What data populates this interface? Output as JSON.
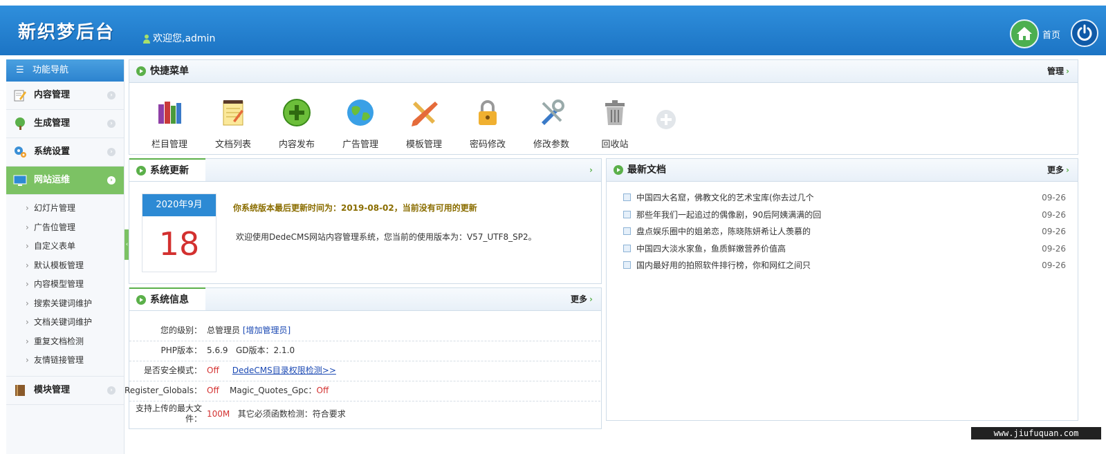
{
  "header": {
    "logo": "新织梦后台",
    "welcome": "欢迎您,admin",
    "home_label": "首页"
  },
  "sidebar": {
    "title": "功能导航",
    "menus": [
      {
        "label": "内容管理"
      },
      {
        "label": "生成管理"
      },
      {
        "label": "系统设置"
      },
      {
        "label": "网站运维"
      }
    ],
    "sub_items": [
      "幻灯片管理",
      "广告位管理",
      "自定义表单",
      "默认模板管理",
      "内容模型管理",
      "搜索关键词维护",
      "文档关键词维护",
      "重复文档检测",
      "友情链接管理"
    ],
    "module_menu": "模块管理"
  },
  "quick_menu": {
    "title": "快捷菜单",
    "manage": "管理",
    "items": [
      {
        "label": "栏目管理",
        "icon": "books-icon"
      },
      {
        "label": "文档列表",
        "icon": "notepad-icon"
      },
      {
        "label": "内容发布",
        "icon": "plus-circle-icon"
      },
      {
        "label": "广告管理",
        "icon": "globe-icon"
      },
      {
        "label": "模板管理",
        "icon": "pencil-ruler-icon"
      },
      {
        "label": "密码修改",
        "icon": "lock-icon"
      },
      {
        "label": "修改参数",
        "icon": "tools-icon"
      },
      {
        "label": "回收站",
        "icon": "trash-icon"
      }
    ]
  },
  "system_update": {
    "title": "系统更新",
    "month": "2020年9月",
    "day": "18",
    "message": "你系统版本最后更新时间为：2019-08-02，当前没有可用的更新",
    "description": "欢迎使用DedeCMS网站内容管理系统，您当前的使用版本为：V57_UTF8_SP2。"
  },
  "latest_docs": {
    "title": "最新文档",
    "more": "更多",
    "items": [
      {
        "title": "中国四大名窟，佛教文化的艺术宝库(你去过几个",
        "date": "09-26"
      },
      {
        "title": "那些年我们一起追过的偶像剧，90后阿姨满满的回",
        "date": "09-26"
      },
      {
        "title": "盘点娱乐圈中的姐弟恋，陈晓陈妍希让人羡慕的",
        "date": "09-26"
      },
      {
        "title": "中国四大淡水家鱼，鱼质鲜嫩营养价值高",
        "date": "09-26"
      },
      {
        "title": "国内最好用的拍照软件排行榜，你和网红之间只",
        "date": "09-26"
      }
    ]
  },
  "system_info": {
    "title": "系统信息",
    "more": "更多",
    "level_label": "您的级别：",
    "level_value": "总管理员",
    "add_admin": "[增加管理员]",
    "php_label": "PHP版本：",
    "php_value": "5.6.9",
    "gd_text": "GD版本：2.1.0",
    "safe_label": "是否安全模式：",
    "safe_value": "Off",
    "perm_link": "DedeCMS目录权限检测>>",
    "rg_label": "Register_Globals：",
    "rg_value": "Off",
    "mq_label": "Magic_Quotes_Gpc：",
    "mq_value": "Off",
    "upload_label": "支持上传的最大文件：",
    "upload_value": "100M",
    "func_text": "其它必须函数检测：符合要求"
  },
  "watermark": "www.jiufuquan.com",
  "colors": {
    "header": "#2581d2",
    "accent_green": "#5bb04a",
    "active_menu": "#7cc264",
    "alert_red": "#d3302f"
  }
}
